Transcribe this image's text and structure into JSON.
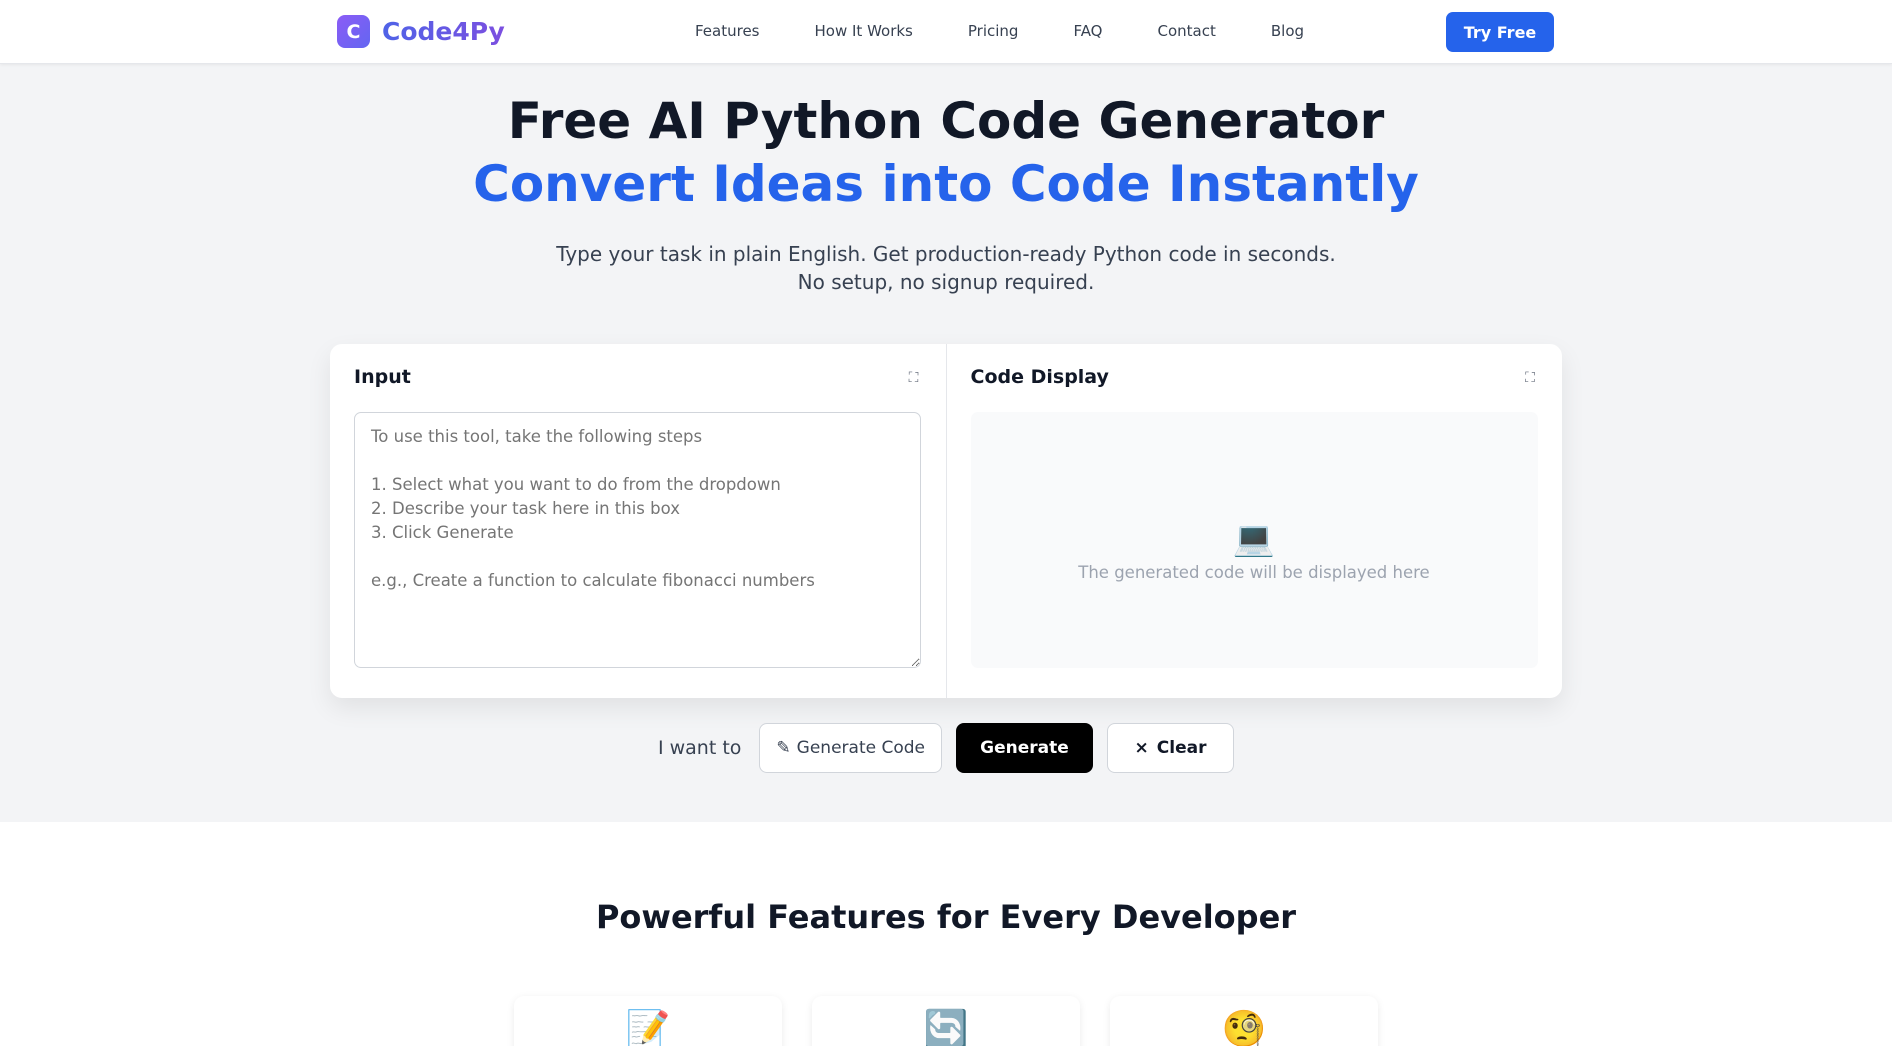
{
  "header": {
    "logo_letter": "C",
    "logo_text": "Code4Py",
    "nav": [
      "Features",
      "How It Works",
      "Pricing",
      "FAQ",
      "Contact",
      "Blog"
    ],
    "cta": "Try Free"
  },
  "hero": {
    "title": "Free AI Python Code Generator",
    "subtitle": "Convert Ideas into Code Instantly",
    "desc_line1": "Type your task in plain English. Get production-ready Python code in seconds.",
    "desc_line2": "No setup, no signup required."
  },
  "tool": {
    "input_title": "Input",
    "input_placeholder": "To use this tool, take the following steps\n\n1. Select what you want to do from the dropdown\n2. Describe your task here in this box\n3. Click Generate\n\ne.g., Create a function to calculate fibonacci numbers",
    "output_title": "Code Display",
    "output_placeholder": "The generated code will be displayed here",
    "expand_glyph": "⛶"
  },
  "controls": {
    "label": "I want to",
    "mode": "Generate Code",
    "generate": "Generate",
    "clear": "Clear",
    "clear_glyph": "×",
    "mode_glyph": "✎"
  },
  "features": {
    "title": "Powerful Features for Every Developer",
    "icons": [
      "📝",
      "🔄",
      "🧐"
    ]
  },
  "colors": {
    "accent": "#2563eb",
    "logo_gradient_start": "#8b5cf6",
    "logo_gradient_end": "#6366f1"
  }
}
